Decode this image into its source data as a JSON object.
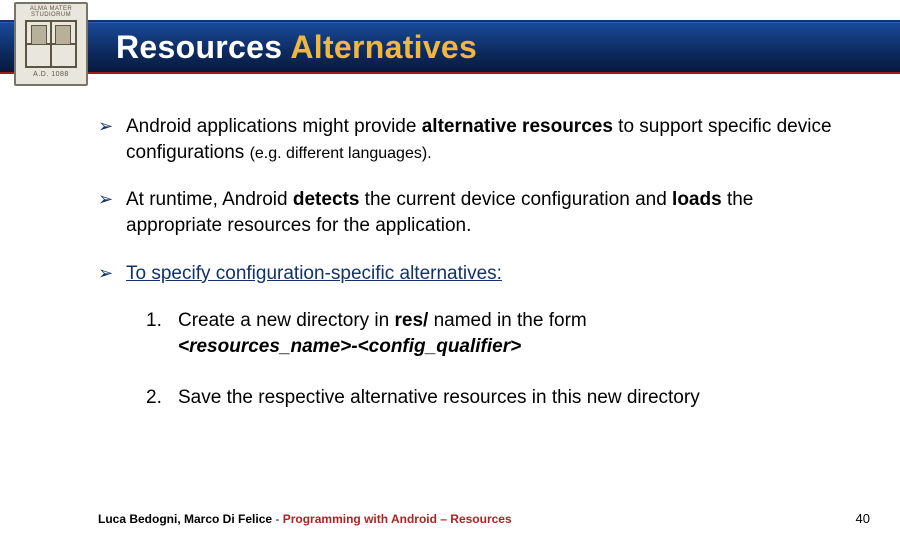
{
  "logo": {
    "top_text": "ALMA MATER STUDIORUM",
    "year_text": "A.D. 1088"
  },
  "title": {
    "part1": "Resources ",
    "part2": "Alternatives"
  },
  "bullets": {
    "b1_a": "Android applications might provide ",
    "b1_b": "alternative resources",
    "b1_c": " to support specific device configurations ",
    "b1_d": "(e.g. different languages).",
    "b2_a": "At runtime, Android ",
    "b2_b": "detects",
    "b2_c": " the current device configuration and ",
    "b2_d": "loads",
    "b2_e": " the appropriate resources for the application.",
    "b3": "To specify configuration-specific alternatives:"
  },
  "steps": {
    "s1_num": "1.",
    "s1_a": "Create a new directory in ",
    "s1_b": "res/",
    "s1_c": " named in the form ",
    "s1_d": "<resources_name>-<config_qualifier>",
    "s2_num": "2.",
    "s2": "Save the respective alternative resources in this new directory"
  },
  "footer": {
    "authors": "Luca Bedogni, Marco Di Felice",
    "sep": " - ",
    "course": "Programming with Android – Resources",
    "page": "40"
  }
}
